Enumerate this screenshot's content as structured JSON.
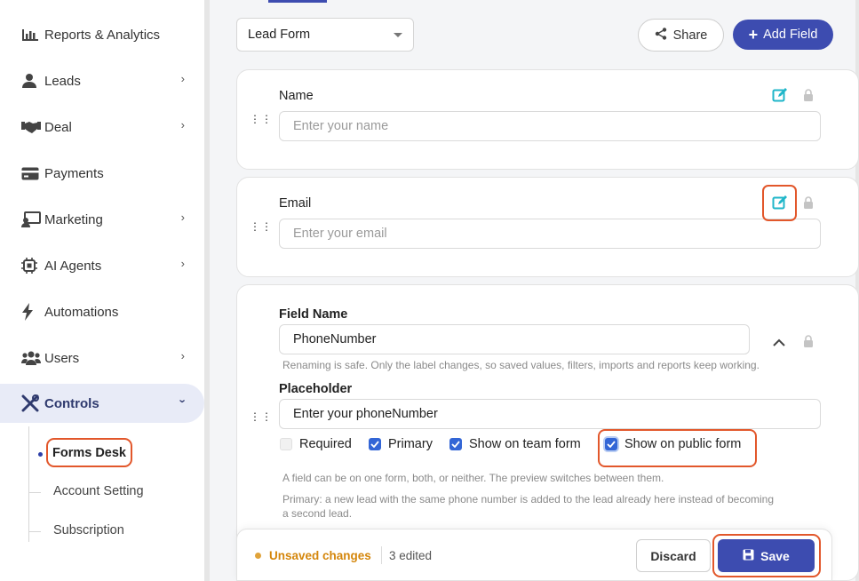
{
  "sidebar": {
    "items": [
      {
        "label": "Reports & Analytics",
        "icon": "bar-chart-icon",
        "chevron": false
      },
      {
        "label": "Leads",
        "icon": "person-icon",
        "chevron": true
      },
      {
        "label": "Deal",
        "icon": "handshake-icon",
        "chevron": true
      },
      {
        "label": "Payments",
        "icon": "credit-card-icon",
        "chevron": false
      },
      {
        "label": "Marketing",
        "icon": "presentation-icon",
        "chevron": true
      },
      {
        "label": "AI Agents",
        "icon": "chip-icon",
        "chevron": true
      },
      {
        "label": "Automations",
        "icon": "bolt-icon",
        "chevron": false
      },
      {
        "label": "Users",
        "icon": "users-icon",
        "chevron": true
      },
      {
        "label": "Controls",
        "icon": "tools-icon",
        "chevron": true,
        "active": true
      }
    ],
    "sub_items": [
      "Forms Desk",
      "Account Setting",
      "Subscription"
    ]
  },
  "toolbar": {
    "form_select": "Lead Form",
    "share_label": "Share",
    "add_field_label": "Add Field"
  },
  "fields": {
    "name": {
      "label": "Name",
      "placeholder": "Enter your name"
    },
    "email": {
      "label": "Email",
      "placeholder": "Enter your email"
    },
    "phone": {
      "field_name_label": "Field Name",
      "field_name_value": "PhoneNumber",
      "rename_hint": "Renaming is safe. Only the label changes, so saved values, filters, imports and reports keep working.",
      "placeholder_label": "Placeholder",
      "placeholder_value": "Enter your phoneNumber",
      "options": {
        "required": "Required",
        "primary": "Primary",
        "team_form": "Show on team form",
        "public_form": "Show on public form"
      },
      "hint_forms": "A field can be on one form, both, or neither. The preview switches between them.",
      "hint_primary_1": "Primary: a new lead with the same phone number is added to the lead already here instead of becoming",
      "hint_primary_2": "a second lead."
    }
  },
  "footer": {
    "unsaved": "Unsaved changes",
    "edited": "3 edited",
    "discard": "Discard",
    "save": "Save"
  },
  "colors": {
    "accent": "#3d4cb0",
    "highlight": "#e2572b",
    "checkbox": "#3366d6",
    "edit_icon": "#1fb6c9",
    "warning": "#d4860b"
  }
}
